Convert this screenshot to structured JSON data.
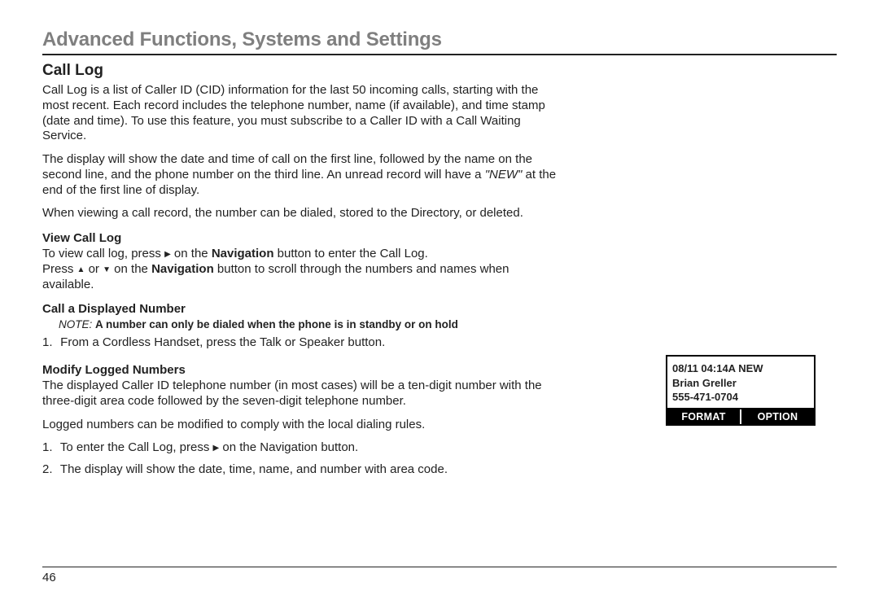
{
  "header": "Advanced Functions, Systems and Settings",
  "title": "Call Log",
  "intro_p1a": "Call Log is a list of Caller ID (CID) information for the last 50 incoming calls, starting with the most recent. Each record includes the telephone number, name (if available), and time stamp (date and time). To use this feature, you must subscribe to a Caller ID with a Call Waiting Service.",
  "intro_p2_pre": "The display will show the date and time of call on the first line, followed by the name on the second line, and the phone number on the third line. An unread record will have a ",
  "intro_p2_italic": "\"NEW\"",
  "intro_p2_post": " at the end of the first line of display.",
  "intro_p3": "When viewing a call record, the number can be dialed, stored to the Directory, or deleted.",
  "view": {
    "heading": "View Call Log",
    "line1_pre": "To view call log, press ",
    "line1_mid": " on the ",
    "nav_word": "Navigation",
    "line1_post": " button to enter the Call Log.",
    "line2_pre": "Press ",
    "line2_or": " or ",
    "line2_mid": " on the ",
    "line2_post": " button to scroll through the numbers and names when available."
  },
  "call": {
    "heading": "Call a Displayed Number",
    "note_label": "NOTE:",
    "note_body": "A number can only be dialed when the phone is in standby or on hold",
    "step1_pre": "From a Cordless Handset, press the ",
    "talk": "Talk",
    "or_word": " or ",
    "speaker": "Speaker",
    "step1_post": " button."
  },
  "modify": {
    "heading": "Modify Logged Numbers",
    "p1": "The displayed Caller ID telephone number (in most cases) will be a ten-digit number with the three-digit area code followed by the seven-digit telephone number.",
    "p2": "Logged numbers can be modified to comply with the local dialing rules.",
    "step1_pre": "To enter the Call Log,  press ",
    "step1_mid": " on the ",
    "step1_post": " button.",
    "step2": "The display will show the date, time, name, and number with area code."
  },
  "phone": {
    "line1": "08/11 04:14A NEW",
    "line2": "Brian Greller",
    "line3": "555-471-0704",
    "btn_left": "FORMAT",
    "btn_right": "OPTION"
  },
  "footer_page": "46"
}
